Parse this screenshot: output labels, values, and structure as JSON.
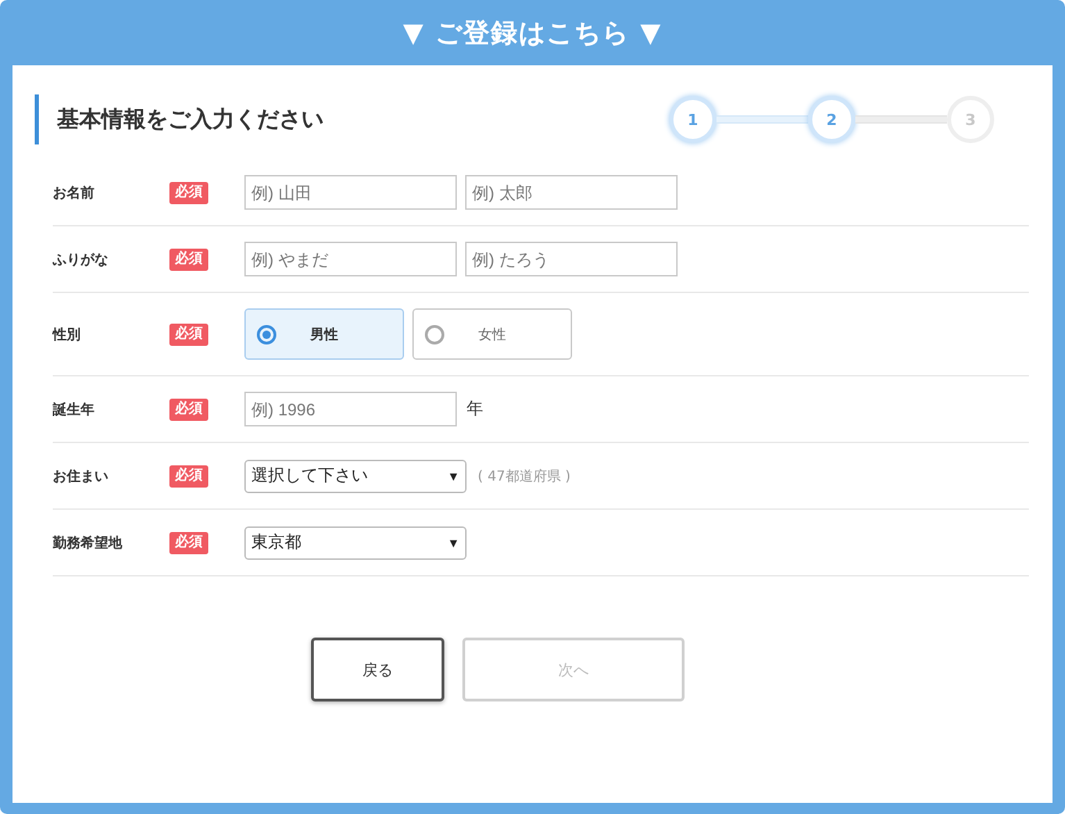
{
  "header": {
    "title": "▼ ご登録はこちら ▼"
  },
  "section": {
    "title": "基本情報をご入力ください"
  },
  "steps": [
    {
      "label": "1",
      "active": true
    },
    {
      "label": "2",
      "active": true
    },
    {
      "label": "3",
      "active": false
    }
  ],
  "rows": [
    {
      "kind": "text-pair",
      "label": "お名前",
      "badge": "必須",
      "fields": [
        {
          "placeholder": "例) 山田"
        },
        {
          "placeholder": "例) 太郎"
        }
      ]
    },
    {
      "kind": "text-pair",
      "label": "ふりがな",
      "badge": "必須",
      "fields": [
        {
          "placeholder": "例) やまだ"
        },
        {
          "placeholder": "例) たろう"
        }
      ]
    },
    {
      "kind": "radio",
      "label": "性別",
      "badge": "必須",
      "options": [
        {
          "label": "男性",
          "selected": true
        },
        {
          "label": "女性",
          "selected": false
        }
      ]
    },
    {
      "kind": "text-unit",
      "label": "誕生年",
      "badge": "必須",
      "fields": [
        {
          "placeholder": "例) 1996"
        }
      ],
      "unit": "年"
    },
    {
      "kind": "select",
      "label": "お住まい",
      "badge": "必須",
      "value": "選択して下さい",
      "arrow": "▼",
      "note": "( 47都道府県 )"
    },
    {
      "kind": "select",
      "label": "勤務希望地",
      "badge": "必須",
      "value": "東京都",
      "arrow": "▼"
    }
  ],
  "buttons": [
    {
      "label": "戻る",
      "disabled": false
    },
    {
      "label": "次へ",
      "disabled": true
    }
  ]
}
